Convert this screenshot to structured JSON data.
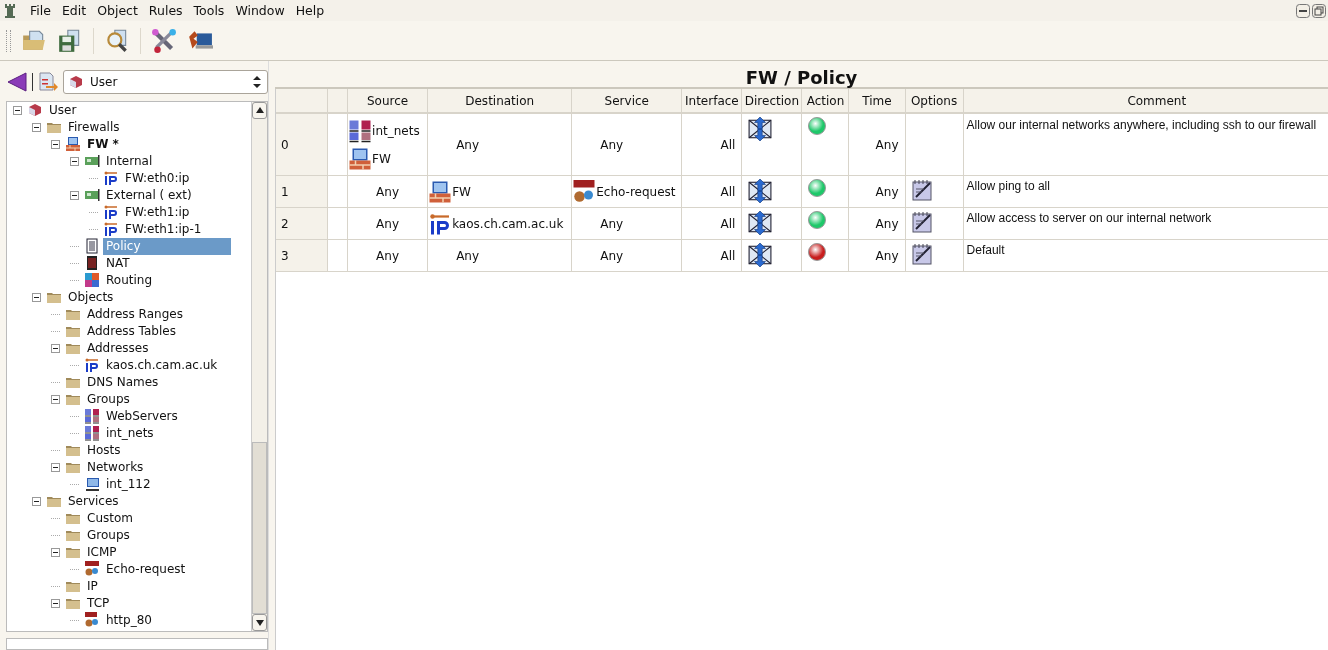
{
  "menu": [
    {
      "label": "File"
    },
    {
      "label": "Edit"
    },
    {
      "label": "Object"
    },
    {
      "label": "Rules"
    },
    {
      "label": "Tools"
    },
    {
      "label": "Window"
    },
    {
      "label": "Help"
    }
  ],
  "library": {
    "value": "User"
  },
  "tree": [
    {
      "label": "User",
      "kind": "library",
      "expanded": true,
      "selected": false,
      "children": [
        {
          "label": "Firewalls",
          "kind": "folder",
          "expanded": true,
          "selected": false,
          "children": [
            {
              "label": "FW *",
              "kind": "firewall",
              "bold": true,
              "expanded": true,
              "selected": false,
              "children": [
                {
                  "label": "Internal",
                  "kind": "interface",
                  "expanded": true,
                  "selected": false,
                  "children": [
                    {
                      "label": "FW:eth0:ip",
                      "kind": "address",
                      "selected": false
                    }
                  ]
                },
                {
                  "label": "External ( ext)",
                  "kind": "interface",
                  "expanded": true,
                  "selected": false,
                  "children": [
                    {
                      "label": "FW:eth1:ip",
                      "kind": "address",
                      "selected": false
                    },
                    {
                      "label": "FW:eth1:ip-1",
                      "kind": "address",
                      "selected": false
                    }
                  ]
                },
                {
                  "label": "Policy",
                  "kind": "policy",
                  "selected": true
                },
                {
                  "label": "NAT",
                  "kind": "nat",
                  "selected": false
                },
                {
                  "label": "Routing",
                  "kind": "routing",
                  "selected": false
                }
              ]
            }
          ]
        },
        {
          "label": "Objects",
          "kind": "folder",
          "expanded": true,
          "selected": false,
          "children": [
            {
              "label": "Address Ranges",
              "kind": "folder",
              "selected": false
            },
            {
              "label": "Address Tables",
              "kind": "folder",
              "selected": false
            },
            {
              "label": "Addresses",
              "kind": "folder",
              "expanded": true,
              "selected": false,
              "children": [
                {
                  "label": "kaos.ch.cam.ac.uk",
                  "kind": "address",
                  "selected": false
                }
              ]
            },
            {
              "label": "DNS Names",
              "kind": "folder",
              "selected": false
            },
            {
              "label": "Groups",
              "kind": "folder",
              "expanded": true,
              "selected": false,
              "children": [
                {
                  "label": "WebServers",
                  "kind": "group",
                  "selected": false
                },
                {
                  "label": "int_nets",
                  "kind": "group",
                  "selected": false
                }
              ]
            },
            {
              "label": "Hosts",
              "kind": "folder",
              "selected": false
            },
            {
              "label": "Networks",
              "kind": "folder",
              "expanded": true,
              "selected": false,
              "children": [
                {
                  "label": "int_112",
                  "kind": "network",
                  "selected": false
                }
              ]
            }
          ]
        },
        {
          "label": "Services",
          "kind": "folder",
          "expanded": true,
          "selected": false,
          "children": [
            {
              "label": "Custom",
              "kind": "folder",
              "selected": false
            },
            {
              "label": "Groups",
              "kind": "folder",
              "selected": false
            },
            {
              "label": "ICMP",
              "kind": "folder",
              "expanded": true,
              "selected": false,
              "children": [
                {
                  "label": "Echo-request",
                  "kind": "icmp",
                  "selected": false
                }
              ]
            },
            {
              "label": "IP",
              "kind": "folder",
              "selected": false
            },
            {
              "label": "TCP",
              "kind": "folder",
              "expanded": true,
              "selected": false,
              "children": [
                {
                  "label": "http_80",
                  "kind": "tcp",
                  "selected": false
                }
              ]
            }
          ]
        }
      ]
    }
  ],
  "policy": {
    "title": "FW / Policy",
    "columns": [
      "Source",
      "Destination",
      "Service",
      "Interface",
      "Direction",
      "Action",
      "Time",
      "Options",
      "Comment"
    ],
    "rows": [
      {
        "number": "0",
        "source": [
          {
            "text": "int_nets",
            "kind": "group"
          },
          {
            "text": "FW",
            "kind": "firewall"
          }
        ],
        "destination": [
          {
            "text": "Any",
            "kind": "any"
          }
        ],
        "service": [
          {
            "text": "Any",
            "kind": "any"
          }
        ],
        "interface": "All",
        "accept": true,
        "time": "Any",
        "options": false,
        "comment": "Allow our internal networks anywhere, including ssh to our firewall"
      },
      {
        "number": "1",
        "source": [
          {
            "text": "Any",
            "kind": "any"
          }
        ],
        "destination": [
          {
            "text": "FW",
            "kind": "firewall"
          }
        ],
        "service": [
          {
            "text": "Echo-request",
            "kind": "icmp"
          }
        ],
        "interface": "All",
        "accept": true,
        "time": "Any",
        "options": true,
        "comment": "Allow ping to all"
      },
      {
        "number": "2",
        "source": [
          {
            "text": "Any",
            "kind": "any"
          }
        ],
        "destination": [
          {
            "text": "kaos.ch.cam.ac.uk",
            "kind": "address"
          }
        ],
        "service": [
          {
            "text": "Any",
            "kind": "any"
          }
        ],
        "interface": "All",
        "accept": true,
        "time": "Any",
        "options": true,
        "comment": "Allow access to server on our internal network"
      },
      {
        "number": "3",
        "source": [
          {
            "text": "Any",
            "kind": "any"
          }
        ],
        "destination": [
          {
            "text": "Any",
            "kind": "any"
          }
        ],
        "service": [
          {
            "text": "Any",
            "kind": "any"
          }
        ],
        "interface": "All",
        "accept": false,
        "time": "Any",
        "options": true,
        "comment": "Default"
      }
    ]
  }
}
